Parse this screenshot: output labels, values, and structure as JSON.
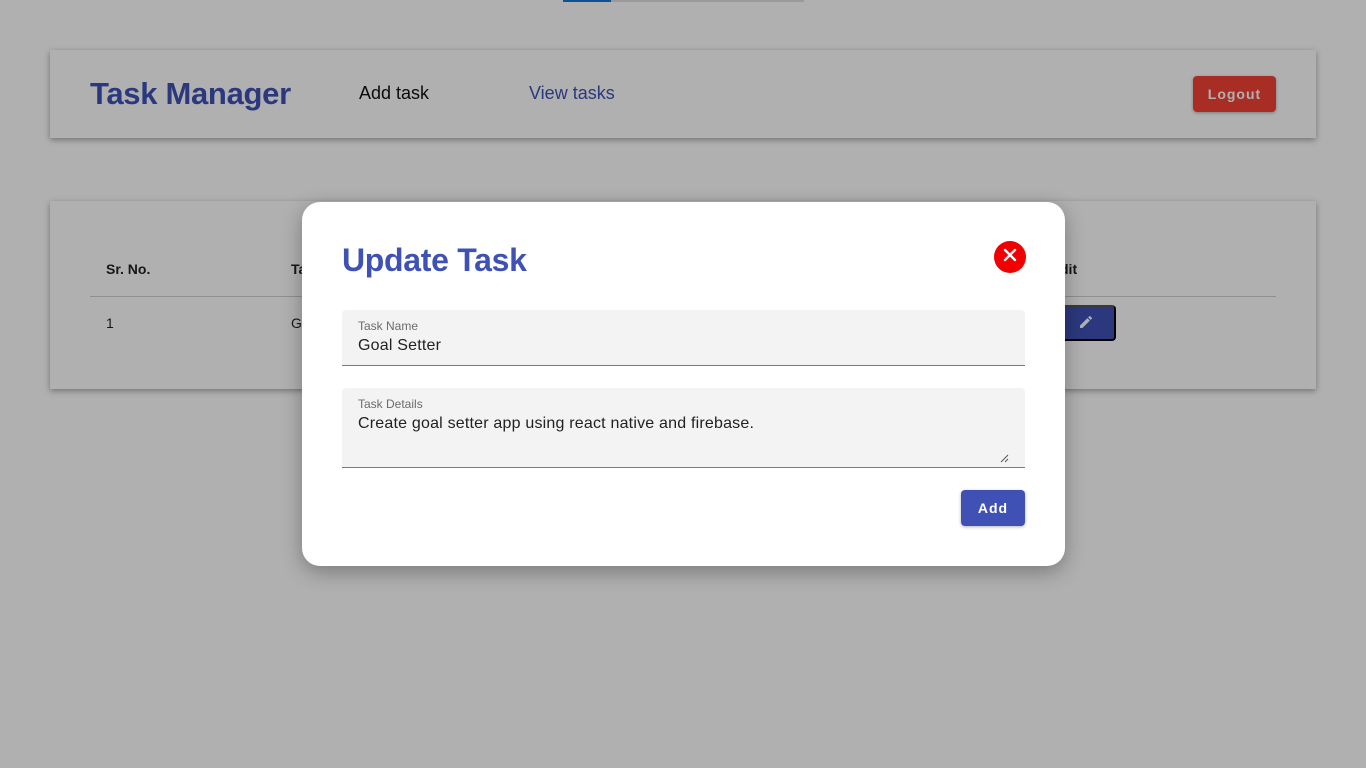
{
  "colors": {
    "primary": "#3f51b5",
    "danger": "#f44336",
    "close": "#f00000",
    "overlay": "rgba(0,0,0,0.31)"
  },
  "top_progress": {
    "fraction": 0.2
  },
  "navbar": {
    "brand": "Task Manager",
    "links": {
      "add_task": "Add task",
      "view_tasks": "View tasks"
    },
    "logout_label": "Logout"
  },
  "table": {
    "headers": {
      "sr_no": "Sr. No.",
      "task_name": "Ta",
      "edit": "dit"
    },
    "rows": [
      {
        "sr_no": "1",
        "task_name": "G",
        "edit_icon": "pencil-icon"
      }
    ]
  },
  "modal": {
    "title": "Update Task",
    "close_icon": "close-icon",
    "fields": {
      "task_name": {
        "label": "Task Name",
        "value": "Goal Setter"
      },
      "task_details": {
        "label": "Task Details",
        "value": "Create goal setter app using react native and firebase."
      }
    },
    "submit_label": "Add"
  }
}
